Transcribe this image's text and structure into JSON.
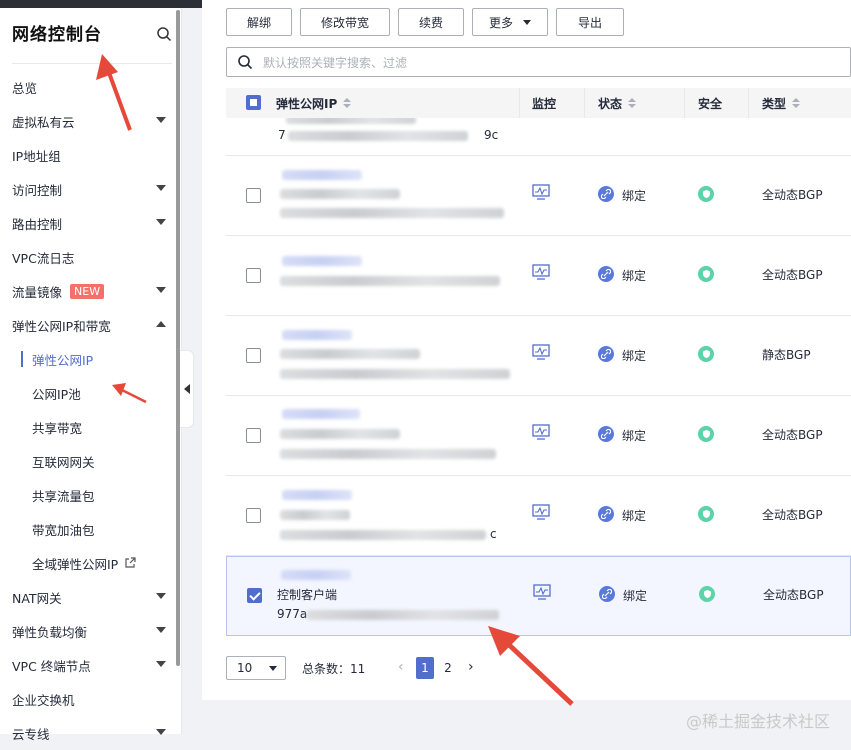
{
  "sidebar": {
    "title": "网络控制台",
    "items": [
      {
        "label": "总览",
        "caret": false
      },
      {
        "label": "虚拟私有云",
        "caret": true
      },
      {
        "label": "IP地址组",
        "caret": false
      },
      {
        "label": "访问控制",
        "caret": true
      },
      {
        "label": "路由控制",
        "caret": true
      },
      {
        "label": "VPC流日志",
        "caret": false
      },
      {
        "label": "流量镜像",
        "caret": true,
        "badge": "NEW"
      },
      {
        "label": "弹性公网IP和带宽",
        "caret": true,
        "expanded": true
      }
    ],
    "sub_items": [
      {
        "label": "弹性公网IP",
        "active": true
      },
      {
        "label": "公网IP池"
      },
      {
        "label": "共享带宽"
      },
      {
        "label": "互联网网关"
      },
      {
        "label": "共享流量包"
      },
      {
        "label": "带宽加油包"
      },
      {
        "label": "全域弹性公网IP",
        "external": true
      }
    ],
    "bottom_items": [
      {
        "label": "NAT网关",
        "caret": true
      },
      {
        "label": "弹性负载均衡",
        "caret": true
      },
      {
        "label": "VPC 终端节点",
        "caret": true
      },
      {
        "label": "企业交换机",
        "caret": false
      },
      {
        "label": "云专线",
        "caret": true
      }
    ]
  },
  "toolbar": {
    "unbind": "解绑",
    "modify_bandwidth": "修改带宽",
    "renew": "续费",
    "more": "更多",
    "export": "导出"
  },
  "search": {
    "placeholder": "默认按照关键字搜索、过滤"
  },
  "table": {
    "headers": {
      "ip": "弹性公网IP",
      "monitor": "监控",
      "status": "状态",
      "security": "安全",
      "type": "类型"
    },
    "partial_row": {
      "ip_start": "7",
      "ip_end": "9c"
    },
    "rows": [
      {
        "status": "绑定",
        "type": "全动态BGP",
        "name": "",
        "ip_start": "",
        "ip_end": "",
        "checked": false
      },
      {
        "status": "绑定",
        "type": "全动态BGP",
        "name": "",
        "ip_start": "",
        "ip_end": "",
        "checked": false
      },
      {
        "status": "绑定",
        "type": "静态BGP",
        "name": "",
        "ip_start": "",
        "ip_end": "",
        "checked": false
      },
      {
        "status": "绑定",
        "type": "全动态BGP",
        "name": "",
        "ip_start": "",
        "ip_end": "",
        "checked": false
      },
      {
        "status": "绑定",
        "type": "全动态BGP",
        "name": "",
        "ip_start": "",
        "ip_end": "c",
        "checked": false
      },
      {
        "status": "绑定",
        "type": "全动态BGP",
        "name": "控制客户端",
        "ip_start": "977a",
        "ip_end": "",
        "checked": true
      }
    ]
  },
  "pagination": {
    "page_size": "10",
    "total_label": "总条数：",
    "total": "11",
    "pages": [
      "1",
      "2"
    ],
    "current": "1"
  },
  "watermark": "@稀土掘金技术社区",
  "colors": {
    "accent": "#526ecc",
    "badge": "#f66f6a",
    "arrow": "#e5493a",
    "security": "#5cd3a8"
  }
}
